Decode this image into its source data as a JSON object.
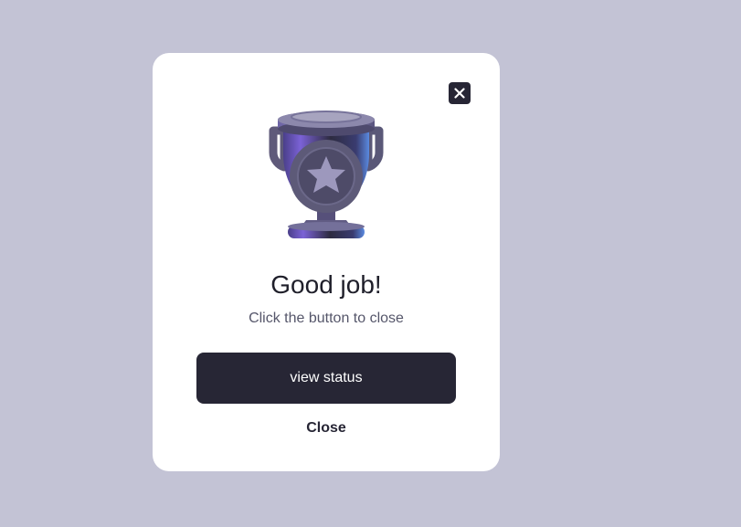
{
  "modal": {
    "title": "Good job!",
    "subtitle": "Click the button to close",
    "primary_button": "view status",
    "close_link": "Close",
    "close_icon": "close-icon",
    "illustration": "trophy-icon"
  },
  "colors": {
    "backdrop": "#c3c3d5",
    "button": "#272635",
    "trophy": "#6a5acd"
  }
}
